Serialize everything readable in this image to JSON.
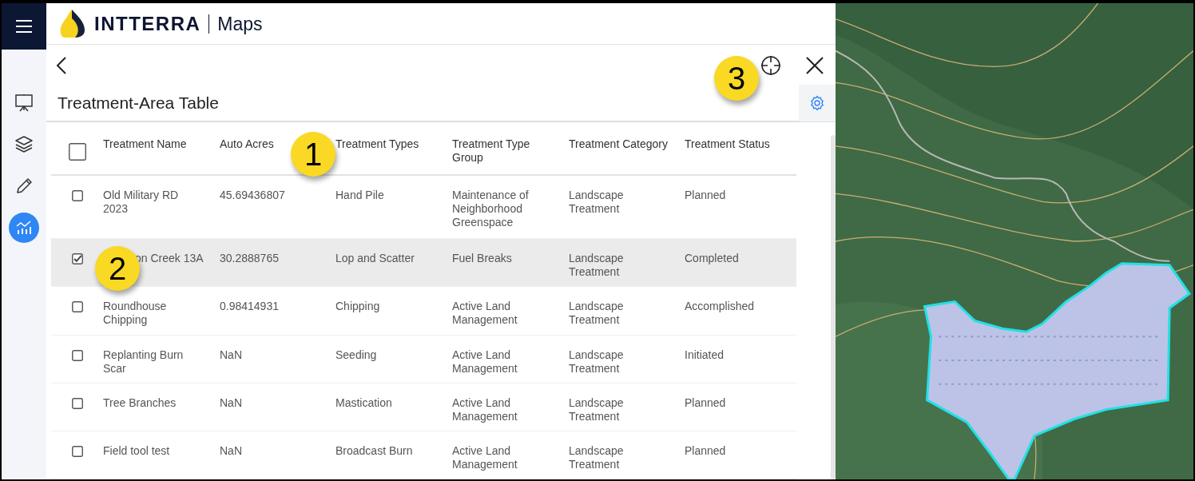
{
  "nav": {
    "items": [
      {
        "kind": "presentation",
        "selected": false
      },
      {
        "kind": "layers",
        "selected": false
      },
      {
        "kind": "pencil",
        "selected": false
      },
      {
        "kind": "chart",
        "selected": true
      }
    ]
  },
  "header": {
    "brand": "INTTERRA",
    "product": "Maps"
  },
  "panel": {
    "title": "Treatment-Area Table"
  },
  "table": {
    "all_checked": false,
    "columns": [
      "Treatment Name",
      "Auto Acres",
      "Treatment Types",
      "Treatment Type Group",
      "Treatment Category",
      "Treatment Status"
    ],
    "rows": [
      {
        "checked": false,
        "selected": false,
        "cells": [
          "Old Military RD 2023",
          "45.69436807",
          "Hand Pile",
          "Maintenance of Neighborhood Greenspace",
          "Landscape Treatment",
          "Planned"
        ]
      },
      {
        "checked": true,
        "selected": true,
        "cells": [
          "on Creek 13A",
          "30.2888765",
          "Lop and Scatter",
          "Fuel Breaks",
          "Landscape Treatment",
          "Completed"
        ]
      },
      {
        "checked": false,
        "selected": false,
        "cells": [
          "Roundhouse Chipping",
          "0.98414931",
          "Chipping",
          "Active Land Management",
          "Landscape Treatment",
          "Accomplished"
        ]
      },
      {
        "checked": false,
        "selected": false,
        "cells": [
          "Replanting Burn Scar",
          "NaN",
          "Seeding",
          "Active Land Management",
          "Landscape Treatment",
          "Initiated"
        ]
      },
      {
        "checked": false,
        "selected": false,
        "cells": [
          "Tree Branches",
          "NaN",
          "Mastication",
          "Active Land Management",
          "Landscape Treatment",
          "Planned"
        ]
      },
      {
        "checked": false,
        "selected": false,
        "cells": [
          "Field tool test",
          "NaN",
          "Broadcast Burn",
          "Active Land Management",
          "Landscape Treatment",
          "Planned"
        ]
      }
    ]
  },
  "callouts": [
    {
      "label": "1"
    },
    {
      "label": "2"
    },
    {
      "label": "3"
    }
  ]
}
